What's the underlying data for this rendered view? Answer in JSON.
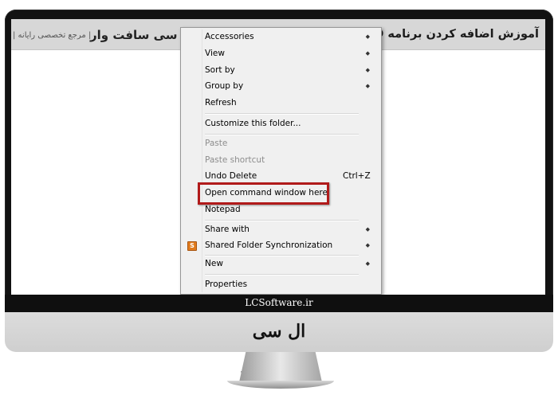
{
  "banner": {
    "title": "آموزش اضافه کردن برنامه CMD به کلیک راست ویندوز",
    "logo": "ال سی سافت وار",
    "tagline": "| مرجع تخصصی رایانه |",
    "arrow": "«"
  },
  "menu": {
    "items": [
      {
        "label": "Accessories",
        "submenu": true
      },
      {
        "label": "View",
        "submenu": true
      },
      {
        "label": "Sort by",
        "submenu": true
      },
      {
        "label": "Group by",
        "submenu": true
      },
      {
        "label": "Refresh"
      },
      {
        "label": "Customize this folder..."
      },
      {
        "label": "Paste",
        "disabled": true
      },
      {
        "label": "Paste shortcut",
        "disabled": true
      },
      {
        "label": "Undo Delete",
        "shortcut": "Ctrl+Z"
      },
      {
        "label": "Open command window here",
        "highlighted": true
      },
      {
        "label": "Notepad"
      },
      {
        "label": "Share with",
        "submenu": true
      },
      {
        "label": "Shared Folder Synchronization",
        "submenu": true,
        "icon": "sync-folder-icon"
      },
      {
        "label": "New",
        "submenu": true
      },
      {
        "label": "Properties"
      }
    ],
    "submenu_glyph": "◆",
    "highlight_color": "#b11a1a"
  },
  "monitor": {
    "brand_text": "LCSoftware.ir",
    "chin_logo": "ال سی سافت وار"
  }
}
